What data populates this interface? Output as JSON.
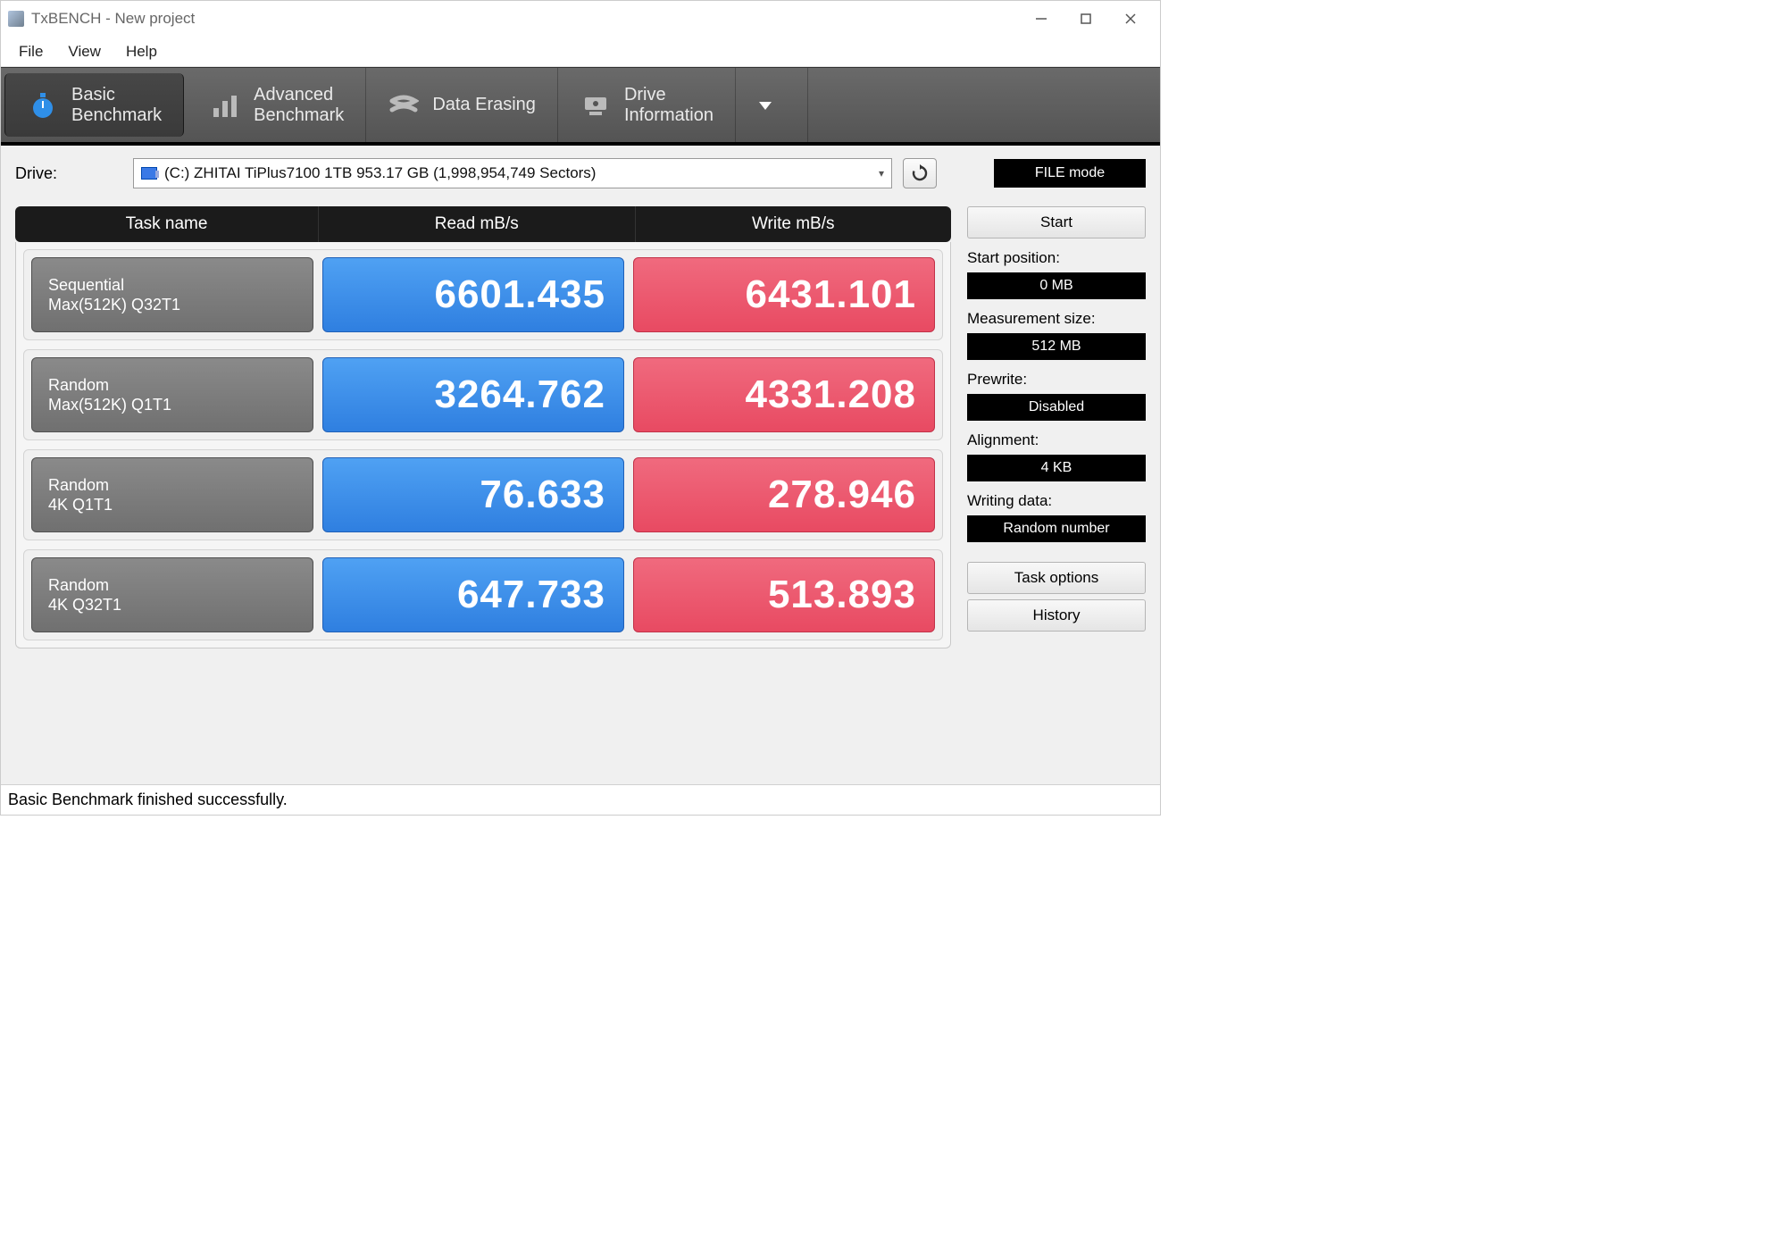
{
  "window": {
    "title": "TxBENCH - New project"
  },
  "menu": {
    "file": "File",
    "view": "View",
    "help": "Help"
  },
  "tabs": {
    "basic": "Basic\nBenchmark",
    "advanced": "Advanced\nBenchmark",
    "erasing": "Data Erasing",
    "driveinfo": "Drive\nInformation"
  },
  "drive": {
    "label": "Drive:",
    "selected": "(C:) ZHITAI TiPlus7100 1TB  953.17 GB (1,998,954,749 Sectors)"
  },
  "filemode_label": "FILE mode",
  "headers": {
    "task": "Task name",
    "read": "Read mB/s",
    "write": "Write mB/s"
  },
  "rows": [
    {
      "name1": "Sequential",
      "name2": "Max(512K) Q32T1",
      "read": "6601.435",
      "write": "6431.101"
    },
    {
      "name1": "Random",
      "name2": "Max(512K) Q1T1",
      "read": "3264.762",
      "write": "4331.208"
    },
    {
      "name1": "Random",
      "name2": "4K Q1T1",
      "read": "76.633",
      "write": "278.946"
    },
    {
      "name1": "Random",
      "name2": "4K Q32T1",
      "read": "647.733",
      "write": "513.893"
    }
  ],
  "sidebar": {
    "start": "Start",
    "start_pos_label": "Start position:",
    "start_pos": "0 MB",
    "meas_label": "Measurement size:",
    "meas": "512 MB",
    "prewrite_label": "Prewrite:",
    "prewrite": "Disabled",
    "align_label": "Alignment:",
    "align": "4 KB",
    "wdata_label": "Writing data:",
    "wdata": "Random number",
    "task_options": "Task options",
    "history": "History"
  },
  "status": "Basic Benchmark finished successfully.",
  "chart_data": {
    "type": "table",
    "title": "TxBENCH Basic Benchmark results (mB/s)",
    "columns": [
      "Task name",
      "Read mB/s",
      "Write mB/s"
    ],
    "rows": [
      [
        "Sequential Max(512K) Q32T1",
        6601.435,
        6431.101
      ],
      [
        "Random Max(512K) Q1T1",
        3264.762,
        4331.208
      ],
      [
        "Random 4K Q1T1",
        76.633,
        278.946
      ],
      [
        "Random 4K Q32T1",
        647.733,
        513.893
      ]
    ]
  }
}
